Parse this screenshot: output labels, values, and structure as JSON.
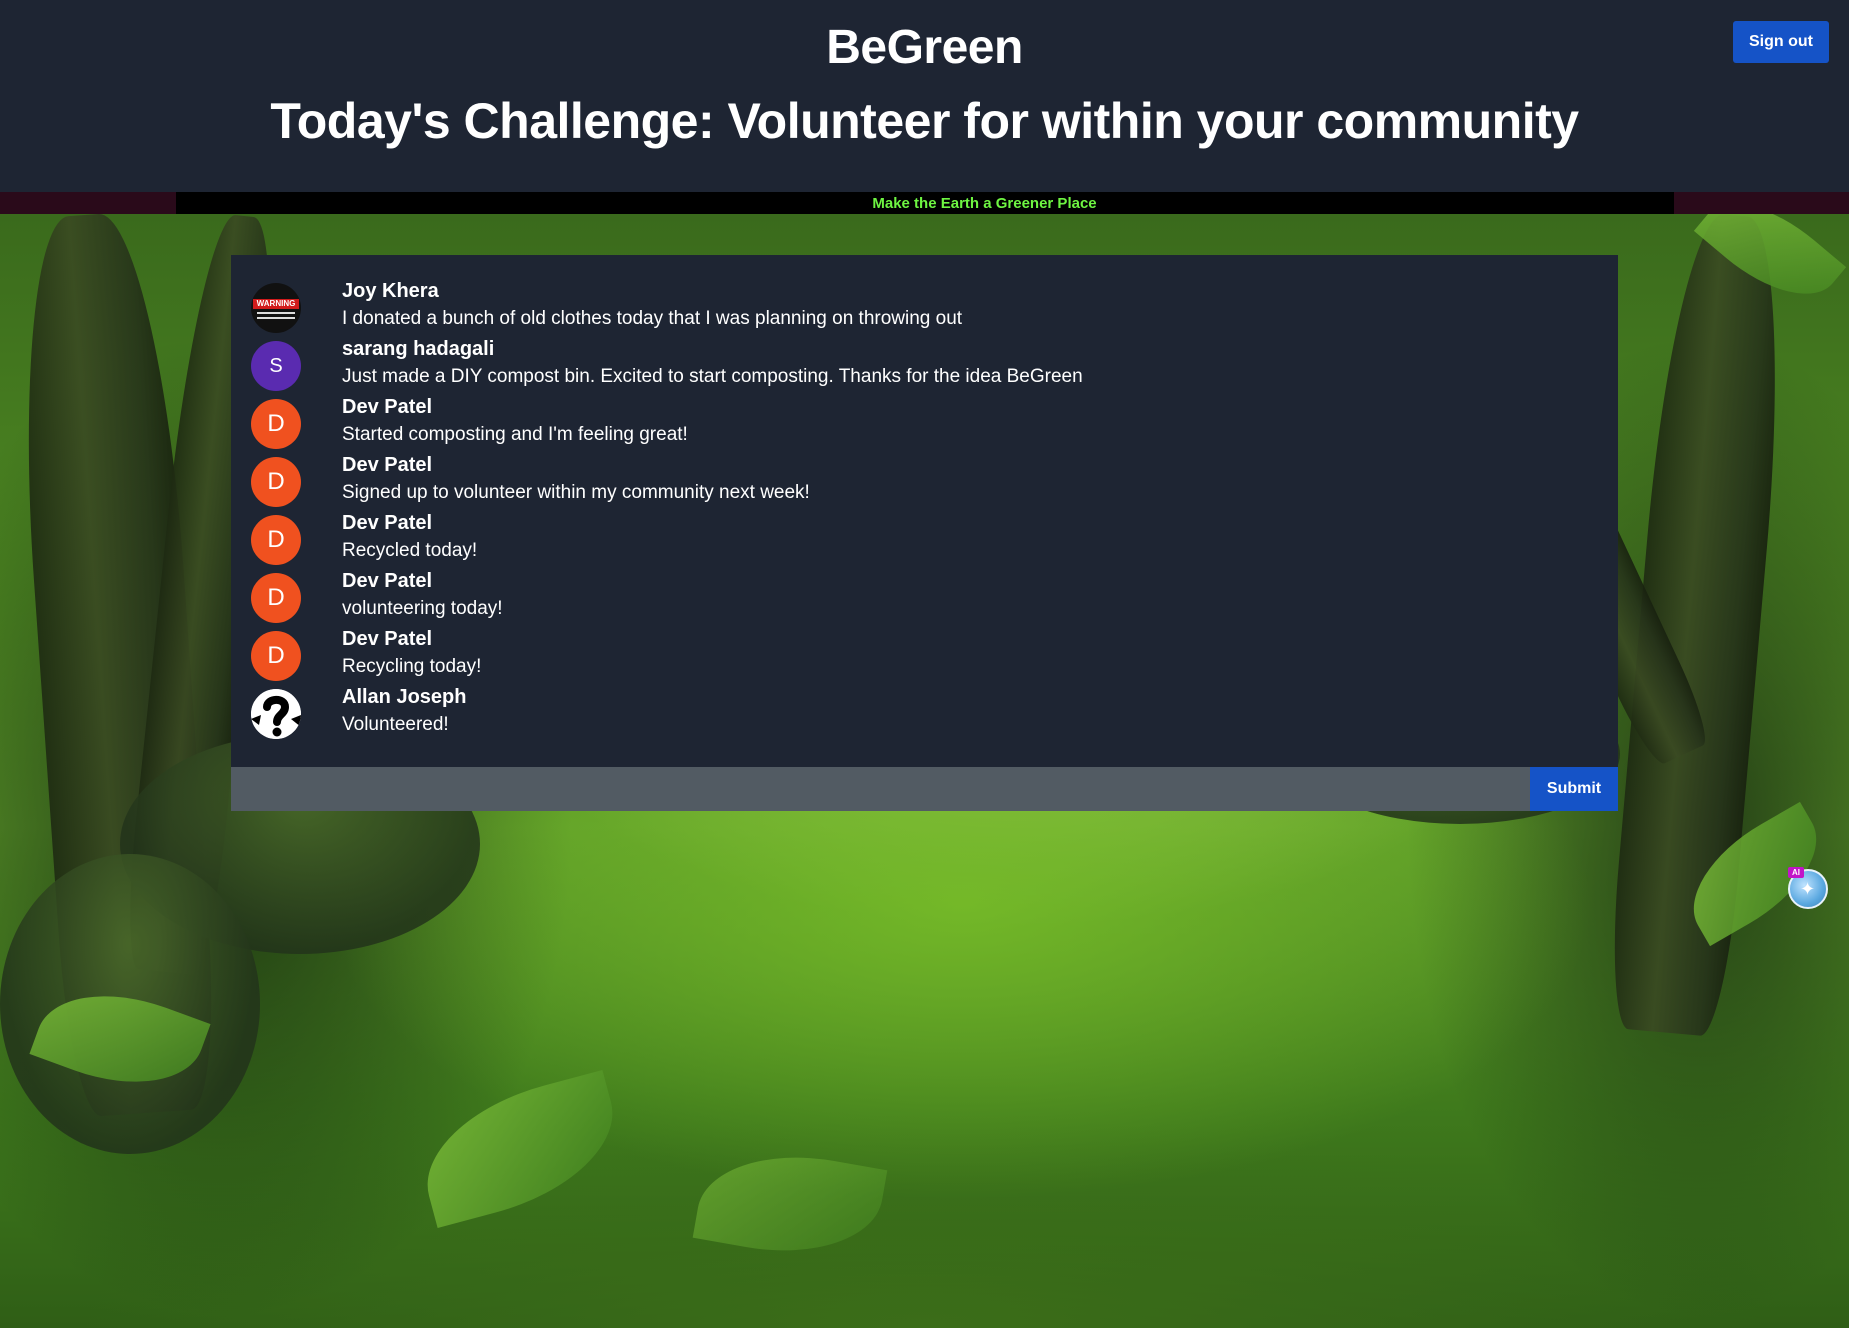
{
  "header": {
    "app_title": "BeGreen",
    "challenge_title": "Today's Challenge: Volunteer for within your community",
    "signout_label": "Sign out"
  },
  "banner": {
    "tagline": "Make the Earth a Greener Place",
    "tagline_color": "#6ef542"
  },
  "feed": {
    "posts": [
      {
        "name": "Joy Khera",
        "text": "I donated a bunch of old clothes today that I was planning on throwing out",
        "avatar": "warning-image",
        "avatar_text": "WARNING"
      },
      {
        "name": "sarang hadagali",
        "text": "Just made a DIY compost bin. Excited to start composting. Thanks for the idea BeGreen",
        "avatar": "S"
      },
      {
        "name": "Dev Patel",
        "text": "Started composting and I'm feeling great!",
        "avatar": "D"
      },
      {
        "name": "Dev Patel",
        "text": "Signed up to volunteer within my community next week!",
        "avatar": "D"
      },
      {
        "name": "Dev Patel",
        "text": "Recycled today!",
        "avatar": "D"
      },
      {
        "name": "Dev Patel",
        "text": "volunteering today!",
        "avatar": "D"
      },
      {
        "name": "Dev Patel",
        "text": "Recycling today!",
        "avatar": "D"
      },
      {
        "name": "Allan Joseph",
        "text": "Volunteered!",
        "avatar": "question-mark-image"
      }
    ]
  },
  "compose": {
    "value": "",
    "placeholder": "",
    "submit_label": "Submit"
  },
  "widget": {
    "badge": "AI",
    "icon": "assistant-icon"
  },
  "colors": {
    "header_bg": "#1e2533",
    "accent_blue": "#1553c7",
    "avatar_s": "#5a2bb0",
    "avatar_d": "#f0511f"
  }
}
